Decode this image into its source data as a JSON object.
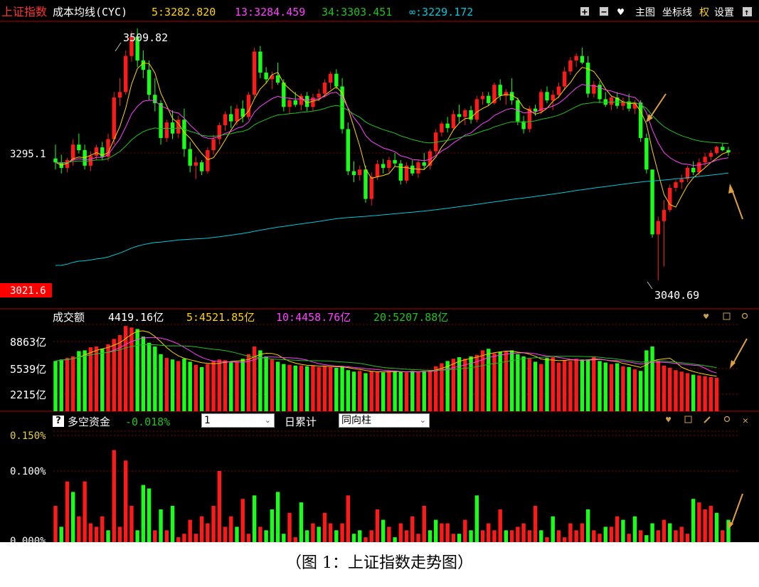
{
  "colors": {
    "up": "#ff1a1a",
    "down": "#1aff1a",
    "ma5": "#ffd200",
    "ma13": "#ff40ff",
    "ma34": "#22c022",
    "ma_inf": "#00c8d8",
    "annotation_arrow": "#e0a040",
    "separator": "#b00000"
  },
  "header": {
    "title": "上证指数",
    "indicator": "成本均线(CYC)",
    "ma5": "5:3282.820",
    "ma13": "13:3284.459",
    "ma34": "34:3303.451",
    "ma_inf": "∞:3229.172",
    "toolbar": {
      "plus_label": "+",
      "minus_label": "−",
      "heart_label": "♥",
      "main_chart": "主图",
      "axis_line": "坐标线",
      "rights": "权",
      "settings": "设置",
      "up_label": "↑"
    }
  },
  "price_panel": {
    "high_label": "3509.82",
    "low_label": "3040.69",
    "axis_mid": "3295.1",
    "axis_low": "3021.6"
  },
  "volume_panel": {
    "title": "成交额",
    "current": "4419.16亿",
    "ma5": "5:4521.85亿",
    "ma10": "10:4458.76亿",
    "ma20": "20:5207.88亿",
    "axis": [
      "8863亿",
      "5539亿",
      "2215亿"
    ]
  },
  "fund_panel": {
    "help": "?",
    "title": "多空资金",
    "value": "-0.018%",
    "period_value": "1",
    "daily_cumulative": "日累计",
    "style_value": "同向柱",
    "axis": [
      "0.150%",
      "0.100%",
      "0.000%"
    ],
    "close": "✕"
  },
  "caption": "（图 1：上证指数走势图）",
  "chart_data": [
    {
      "type": "candlestick",
      "title": "上证指数",
      "ylim": [
        3021.6,
        3520
      ],
      "annotations": [
        {
          "text": "3509.82",
          "value": 3509.82
        },
        {
          "text": "3040.69",
          "value": 3040.69
        }
      ],
      "candles": [
        [
          3275,
          3300,
          3255,
          3268
        ],
        [
          3268,
          3282,
          3248,
          3258
        ],
        [
          3258,
          3276,
          3250,
          3272
        ],
        [
          3272,
          3310,
          3262,
          3300
        ],
        [
          3300,
          3320,
          3284,
          3290
        ],
        [
          3290,
          3300,
          3255,
          3262
        ],
        [
          3262,
          3288,
          3252,
          3280
        ],
        [
          3280,
          3300,
          3272,
          3295
        ],
        [
          3295,
          3305,
          3272,
          3278
        ],
        [
          3278,
          3320,
          3270,
          3310
        ],
        [
          3310,
          3395,
          3300,
          3385
        ],
        [
          3385,
          3420,
          3370,
          3395
        ],
        [
          3395,
          3470,
          3390,
          3460
        ],
        [
          3460,
          3505,
          3450,
          3495
        ],
        [
          3495,
          3510,
          3440,
          3452
        ],
        [
          3452,
          3470,
          3420,
          3435
        ],
        [
          3435,
          3452,
          3380,
          3390
        ],
        [
          3390,
          3420,
          3360,
          3375
        ],
        [
          3375,
          3380,
          3300,
          3312
        ],
        [
          3312,
          3345,
          3305,
          3340
        ],
        [
          3340,
          3362,
          3310,
          3320
        ],
        [
          3320,
          3352,
          3312,
          3345
        ],
        [
          3345,
          3365,
          3278,
          3292
        ],
        [
          3292,
          3305,
          3250,
          3262
        ],
        [
          3262,
          3278,
          3238,
          3268
        ],
        [
          3268,
          3272,
          3245,
          3252
        ],
        [
          3252,
          3295,
          3248,
          3290
        ],
        [
          3290,
          3318,
          3282,
          3310
        ],
        [
          3310,
          3340,
          3300,
          3335
        ],
        [
          3335,
          3360,
          3325,
          3355
        ],
        [
          3355,
          3370,
          3330,
          3342
        ],
        [
          3342,
          3372,
          3335,
          3365
        ],
        [
          3365,
          3380,
          3340,
          3350
        ],
        [
          3350,
          3395,
          3345,
          3390
        ],
        [
          3390,
          3475,
          3385,
          3468
        ],
        [
          3468,
          3478,
          3420,
          3430
        ],
        [
          3430,
          3440,
          3410,
          3418
        ],
        [
          3418,
          3432,
          3400,
          3425
        ],
        [
          3425,
          3448,
          3408,
          3412
        ],
        [
          3412,
          3418,
          3360,
          3368
        ],
        [
          3368,
          3385,
          3355,
          3380
        ],
        [
          3380,
          3395,
          3368,
          3372
        ],
        [
          3372,
          3392,
          3362,
          3388
        ],
        [
          3388,
          3395,
          3360,
          3368
        ],
        [
          3368,
          3392,
          3360,
          3385
        ],
        [
          3385,
          3400,
          3378,
          3392
        ],
        [
          3392,
          3418,
          3385,
          3412
        ],
        [
          3412,
          3432,
          3400,
          3428
        ],
        [
          3428,
          3436,
          3400,
          3405
        ],
        [
          3405,
          3420,
          3320,
          3328
        ],
        [
          3328,
          3340,
          3245,
          3252
        ],
        [
          3252,
          3270,
          3232,
          3245
        ],
        [
          3245,
          3262,
          3235,
          3255
        ],
        [
          3255,
          3262,
          3195,
          3202
        ],
        [
          3202,
          3250,
          3190,
          3242
        ],
        [
          3242,
          3272,
          3236,
          3265
        ],
        [
          3265,
          3274,
          3248,
          3258
        ],
        [
          3258,
          3278,
          3250,
          3272
        ],
        [
          3272,
          3285,
          3260,
          3266
        ],
        [
          3266,
          3272,
          3228,
          3235
        ],
        [
          3235,
          3268,
          3230,
          3262
        ],
        [
          3262,
          3272,
          3244,
          3248
        ],
        [
          3248,
          3272,
          3240,
          3268
        ],
        [
          3268,
          3285,
          3255,
          3262
        ],
        [
          3262,
          3292,
          3255,
          3288
        ],
        [
          3288,
          3328,
          3282,
          3322
        ],
        [
          3322,
          3342,
          3315,
          3338
        ],
        [
          3338,
          3350,
          3322,
          3330
        ],
        [
          3330,
          3362,
          3325,
          3355
        ],
        [
          3355,
          3372,
          3340,
          3350
        ],
        [
          3350,
          3365,
          3335,
          3362
        ],
        [
          3362,
          3370,
          3338,
          3345
        ],
        [
          3345,
          3388,
          3340,
          3382
        ],
        [
          3382,
          3395,
          3372,
          3388
        ],
        [
          3388,
          3395,
          3370,
          3375
        ],
        [
          3375,
          3412,
          3372,
          3408
        ],
        [
          3408,
          3418,
          3380,
          3388
        ],
        [
          3388,
          3400,
          3372,
          3395
        ],
        [
          3395,
          3420,
          3372,
          3380
        ],
        [
          3380,
          3385,
          3335,
          3342
        ],
        [
          3342,
          3352,
          3320,
          3328
        ],
        [
          3328,
          3370,
          3322,
          3365
        ],
        [
          3365,
          3372,
          3352,
          3360
        ],
        [
          3360,
          3400,
          3355,
          3395
        ],
        [
          3395,
          3405,
          3375,
          3380
        ],
        [
          3380,
          3398,
          3362,
          3390
        ],
        [
          3390,
          3412,
          3384,
          3405
        ],
        [
          3405,
          3440,
          3398,
          3432
        ],
        [
          3432,
          3458,
          3426,
          3452
        ],
        [
          3452,
          3465,
          3440,
          3460
        ],
        [
          3460,
          3475,
          3445,
          3448
        ],
        [
          3448,
          3460,
          3385,
          3392
        ],
        [
          3392,
          3415,
          3385,
          3408
        ],
        [
          3408,
          3415,
          3375,
          3382
        ],
        [
          3382,
          3395,
          3368,
          3372
        ],
        [
          3372,
          3388,
          3362,
          3385
        ],
        [
          3385,
          3395,
          3365,
          3370
        ],
        [
          3370,
          3385,
          3362,
          3378
        ],
        [
          3378,
          3392,
          3360,
          3365
        ],
        [
          3365,
          3380,
          3355,
          3376
        ],
        [
          3376,
          3380,
          3305,
          3312
        ],
        [
          3312,
          3320,
          3248,
          3255
        ],
        [
          3255,
          3140,
          3132,
          3138
        ],
        [
          3138,
          3170,
          3055,
          3162
        ],
        [
          3162,
          3200,
          3080,
          3182
        ],
        [
          3182,
          3228,
          3178,
          3222
        ],
        [
          3222,
          3236,
          3215,
          3232
        ],
        [
          3232,
          3246,
          3220,
          3238
        ],
        [
          3238,
          3262,
          3232,
          3258
        ],
        [
          3258,
          3270,
          3245,
          3250
        ],
        [
          3250,
          3275,
          3244,
          3268
        ],
        [
          3268,
          3285,
          3260,
          3278
        ],
        [
          3278,
          3290,
          3272,
          3285
        ],
        [
          3285,
          3298,
          3282,
          3296
        ],
        [
          3296,
          3302,
          3288,
          3290
        ],
        [
          3290,
          3296,
          3280,
          3286
        ]
      ],
      "series": [
        {
          "name": "5"
        },
        {
          "name": "13"
        },
        {
          "name": "34"
        },
        {
          "name": "∞"
        }
      ]
    },
    {
      "type": "bar",
      "title": "成交额",
      "unit": "亿",
      "ylim": [
        0,
        11400
      ],
      "ticks": [
        8863,
        5539,
        2215
      ],
      "values": [
        6600,
        6800,
        7000,
        7200,
        7900,
        8000,
        8400,
        8500,
        8200,
        8800,
        9500,
        10000,
        11200,
        11000,
        10800,
        9800,
        9000,
        8500,
        7500,
        7000,
        6800,
        6600,
        6900,
        6500,
        6100,
        5800,
        6200,
        6600,
        6800,
        6700,
        6400,
        6500,
        6900,
        7500,
        8500,
        8000,
        7200,
        6800,
        6500,
        6200,
        6100,
        6000,
        6000,
        5900,
        6000,
        5800,
        5900,
        5800,
        5700,
        5900,
        5400,
        5200,
        5300,
        5000,
        5300,
        5200,
        5100,
        5300,
        5200,
        5200,
        5100,
        5300,
        5200,
        5300,
        5400,
        5900,
        6300,
        6600,
        6900,
        7100,
        6900,
        7200,
        7400,
        8000,
        8200,
        7600,
        7800,
        7900,
        8000,
        7500,
        7200,
        6900,
        6500,
        6200,
        7000,
        7100,
        6400,
        6700,
        6600,
        6900,
        6800,
        6800,
        7100,
        6600,
        6400,
        6200,
        6300,
        5900,
        5800,
        5500,
        5300,
        8000,
        8500,
        6600,
        6000,
        5700,
        5400,
        5200,
        5000,
        4800,
        4700,
        4600,
        4500,
        4400
      ],
      "series": [
        {
          "name": "5:4521.85亿"
        },
        {
          "name": "10:4458.76亿"
        },
        {
          "name": "20:5207.88亿"
        }
      ]
    },
    {
      "type": "bar",
      "title": "多空资金",
      "unit": "%",
      "ylim": [
        0,
        0.16
      ],
      "ticks": [
        0.15,
        0.1,
        0.0
      ],
      "values": [
        0.05,
        0.02,
        0.085,
        0.07,
        0.035,
        0.085,
        0.025,
        0.02,
        0.035,
        0.015,
        0.13,
        0.02,
        0.115,
        0.05,
        0.015,
        0.08,
        0.075,
        0.015,
        0.045,
        0.015,
        0.05,
        0.005,
        0.01,
        0.03,
        0.01,
        0.035,
        0.025,
        0.05,
        0.1,
        0.02,
        0.035,
        0.02,
        0.06,
        0.01,
        0.065,
        0.02,
        0.015,
        0.045,
        0.07,
        0.01,
        0.04,
        0.005,
        0.055,
        0.015,
        0.025,
        0.02,
        0.04,
        0.025,
        0.015,
        0.025,
        0.065,
        0.01,
        0.015,
        0.005,
        0.015,
        0.045,
        0.03,
        0.02,
        0.005,
        0.025,
        0.015,
        0.035,
        0.01,
        0.05,
        0.015,
        0.03,
        0.025,
        0.025,
        0.01,
        0.01,
        0.03,
        0.015,
        0.065,
        0.015,
        0.025,
        0.015,
        0.045,
        0.015,
        0.015,
        0.02,
        0.025,
        0.015,
        0.05,
        0.015,
        0.005,
        0.035,
        0.015,
        0.005,
        0.025,
        0.015,
        0.025,
        0.045,
        0.015,
        0.01,
        0.02,
        0.02,
        0.035,
        0.03,
        0.01,
        0.035,
        0.015,
        0.008,
        0.025,
        0.015,
        0.03,
        0.025,
        0.015,
        0.02,
        0.01,
        0.06,
        0.055,
        0.045,
        0.05,
        0.04,
        0.015,
        0.03
      ],
      "directions": [
        "up",
        "down",
        "up",
        "down",
        "up",
        "up",
        "up",
        "up",
        "up",
        "down",
        "up",
        "up",
        "up",
        "up",
        "down",
        "down",
        "down",
        "up",
        "down",
        "up",
        "down",
        "up",
        "up",
        "up",
        "up",
        "up",
        "up",
        "up",
        "up",
        "up",
        "up",
        "down",
        "up",
        "up",
        "down",
        "up",
        "down",
        "down",
        "down",
        "down",
        "up",
        "up",
        "down",
        "down",
        "up",
        "down",
        "up",
        "up",
        "down",
        "up",
        "up",
        "down",
        "down",
        "up",
        "up",
        "up",
        "down",
        "up",
        "down",
        "up",
        "up",
        "up",
        "up",
        "up",
        "down",
        "down",
        "up",
        "up",
        "up",
        "down",
        "up",
        "down",
        "down",
        "up",
        "up",
        "up",
        "up",
        "down",
        "up",
        "up",
        "up",
        "up",
        "up",
        "down",
        "up",
        "down",
        "up",
        "up",
        "up",
        "up",
        "up",
        "down",
        "up",
        "up",
        "down",
        "up",
        "up",
        "down",
        "up",
        "down",
        "up",
        "down",
        "down",
        "up",
        "up",
        "down",
        "up",
        "up",
        "up",
        "down",
        "up",
        "up",
        "up",
        "down",
        "up",
        "down"
      ]
    }
  ]
}
